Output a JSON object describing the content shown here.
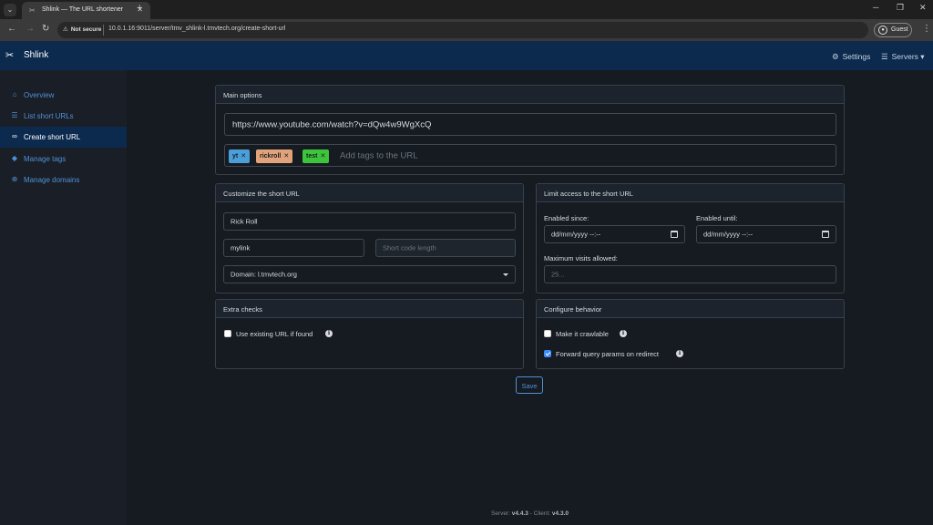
{
  "browser": {
    "tab_title": "Shlink — The URL shortener",
    "security_label": "Not secure",
    "url": "10.0.1.16:9011/server/tmv_shlink-l.tmvtech.org/create-short-url",
    "profile_label": "Guest"
  },
  "header": {
    "brand": "Shlink",
    "settings_label": "Settings",
    "servers_label": "Servers"
  },
  "sidebar": {
    "items": [
      {
        "label": "Overview",
        "icon": "house-icon"
      },
      {
        "label": "List short URLs",
        "icon": "list-icon"
      },
      {
        "label": "Create short URL",
        "icon": "link-icon",
        "active": true
      },
      {
        "label": "Manage tags",
        "icon": "tags-icon"
      },
      {
        "label": "Manage domains",
        "icon": "globe-icon"
      }
    ]
  },
  "main_options": {
    "title": "Main options",
    "long_url": "https://www.youtube.com/watch?v=dQw4w9WgXcQ",
    "tags": [
      {
        "label": "yt",
        "color": "#4a9fd8"
      },
      {
        "label": "rickroll",
        "color": "#e3a37a"
      },
      {
        "label": "test",
        "color": "#3cc53a"
      }
    ],
    "tags_placeholder": "Add tags to the URL"
  },
  "customize": {
    "title": "Customize the short URL",
    "title_value": "Rick Roll",
    "custom_slug": "mylink",
    "short_code_length_placeholder": "Short code length",
    "domain_select": "Domain: l.tmvtech.org"
  },
  "limit_access": {
    "title": "Limit access to the short URL",
    "enabled_since_label": "Enabled since:",
    "enabled_since_value": "dd/mm/yyyy --:--",
    "enabled_until_label": "Enabled until:",
    "enabled_until_value": "dd/mm/yyyy --:--",
    "max_visits_label": "Maximum visits allowed:",
    "max_visits_placeholder": "25..."
  },
  "extra_checks": {
    "title": "Extra checks",
    "use_existing_label": "Use existing URL if found",
    "use_existing_checked": false
  },
  "behavior": {
    "title": "Configure behavior",
    "crawlable_label": "Make it crawlable",
    "crawlable_checked": false,
    "forward_query_label": "Forward query params on redirect",
    "forward_query_checked": true
  },
  "save_label": "Save",
  "footer": {
    "server_prefix": "Server:",
    "server_version": "v4.4.3",
    "separator": "-",
    "client_prefix": "Client:",
    "client_version": "v4.3.0"
  }
}
